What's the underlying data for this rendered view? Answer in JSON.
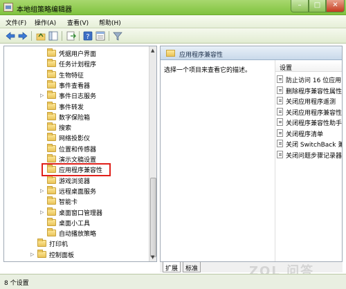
{
  "window": {
    "title": "本地组策略编辑器"
  },
  "menu": {
    "file": "文件(F)",
    "action": "操作(A)",
    "view": "查看(V)",
    "help": "帮助(H)"
  },
  "tree": {
    "items": [
      {
        "label": "凭据用户界面",
        "expand": ""
      },
      {
        "label": "任务计划程序",
        "expand": ""
      },
      {
        "label": "生物特征",
        "expand": ""
      },
      {
        "label": "事件查看器",
        "expand": ""
      },
      {
        "label": "事件日志服务",
        "expand": "▷"
      },
      {
        "label": "事件转发",
        "expand": ""
      },
      {
        "label": "数字保险箱",
        "expand": ""
      },
      {
        "label": "搜索",
        "expand": ""
      },
      {
        "label": "网络投影仪",
        "expand": ""
      },
      {
        "label": "位置和传感器",
        "expand": ""
      },
      {
        "label": "演示文稿设置",
        "expand": ""
      },
      {
        "label": "应用程序兼容性",
        "expand": ""
      },
      {
        "label": "游戏浏览器",
        "expand": ""
      },
      {
        "label": "远程桌面服务",
        "expand": "▷"
      },
      {
        "label": "智能卡",
        "expand": ""
      },
      {
        "label": "桌面窗口管理器",
        "expand": "▷"
      },
      {
        "label": "桌面小工具",
        "expand": ""
      },
      {
        "label": "自动播放策略",
        "expand": ""
      },
      {
        "label": "打印机",
        "expand": ""
      },
      {
        "label": "控制面板",
        "expand": "▷"
      }
    ]
  },
  "right": {
    "header_title": "应用程序兼容性",
    "description": "选择一个项目来查看它的描述。",
    "settings_header": "设置",
    "settings": [
      "防止访问 16 位应用",
      "删除程序兼容性属性",
      "关闭应用程序遥测",
      "关闭应用程序兼容性",
      "关闭程序兼容性助手",
      "关闭程序清单",
      "关闭 SwitchBack 兼",
      "关闭问题步骤记录器"
    ]
  },
  "tabs": {
    "extended": "扩展",
    "standard": "标准"
  },
  "status": {
    "text": "8 个设置"
  },
  "watermark": "ZOL 问答"
}
